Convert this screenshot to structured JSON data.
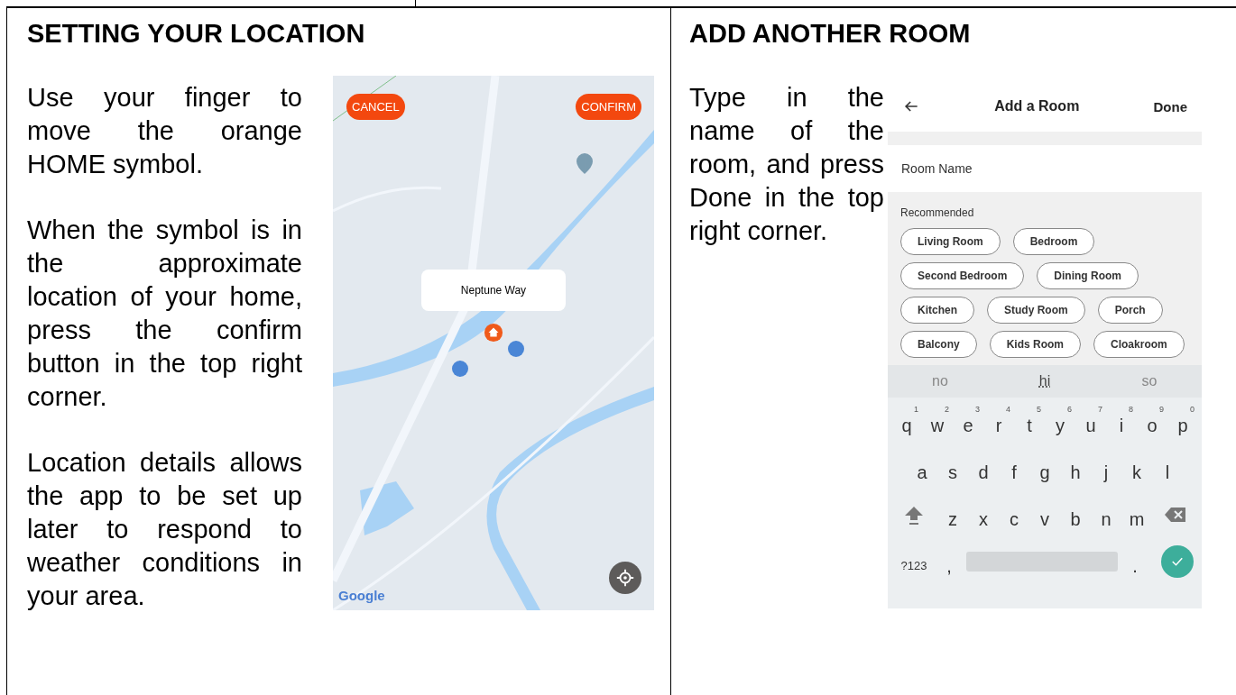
{
  "left": {
    "heading": "SETTING YOUR LOCATION",
    "paragraphs": [
      "Use your finger to move the orange HOME symbol.",
      "When the symbol is in the approximate location of your home, press the confirm button in the top right corner.",
      "Location details allows the app to be set up later to respond to weather conditions in your area."
    ],
    "map": {
      "cancel": "CANCEL",
      "confirm": "CONFIRM",
      "popup": "Neptune Way",
      "attribution": "Google"
    }
  },
  "right": {
    "heading": "ADD ANOTHER ROOM",
    "paragraphs": [
      "Type in the name of the room, and press Done in the top right corner."
    ],
    "app": {
      "title": "Add a Room",
      "done": "Done",
      "field": {
        "placeholder": "Room Name"
      },
      "section_label": "Recommended",
      "chip_rows": [
        [
          "Living Room",
          "Bedroom"
        ],
        [
          "Second Bedroom",
          "Dining Room"
        ],
        [
          "Kitchen",
          "Study Room",
          "Porch"
        ],
        [
          "Balcony",
          "Kids Room",
          "Cloakroom"
        ]
      ],
      "keyboard": {
        "suggestions": [
          {
            "text": "no",
            "selected": false
          },
          {
            "text": "hi",
            "selected": true
          },
          {
            "text": "so",
            "selected": false
          }
        ],
        "rows": [
          [
            {
              "key": "q",
              "hint": "1"
            },
            {
              "key": "w",
              "hint": "2"
            },
            {
              "key": "e",
              "hint": "3"
            },
            {
              "key": "r",
              "hint": "4"
            },
            {
              "key": "t",
              "hint": "5"
            },
            {
              "key": "y",
              "hint": "6"
            },
            {
              "key": "u",
              "hint": "7"
            },
            {
              "key": "i",
              "hint": "8"
            },
            {
              "key": "o",
              "hint": "9"
            },
            {
              "key": "p",
              "hint": "0"
            }
          ],
          [
            {
              "key": "a"
            },
            {
              "key": "s"
            },
            {
              "key": "d"
            },
            {
              "key": "f"
            },
            {
              "key": "g"
            },
            {
              "key": "h"
            },
            {
              "key": "j"
            },
            {
              "key": "k"
            },
            {
              "key": "l"
            }
          ],
          [
            {
              "key": "z"
            },
            {
              "key": "x"
            },
            {
              "key": "c"
            },
            {
              "key": "v"
            },
            {
              "key": "b"
            },
            {
              "key": "n"
            },
            {
              "key": "m"
            }
          ]
        ],
        "symbols_key": "?123",
        "comma_key": ",",
        "period_key": "."
      }
    }
  }
}
